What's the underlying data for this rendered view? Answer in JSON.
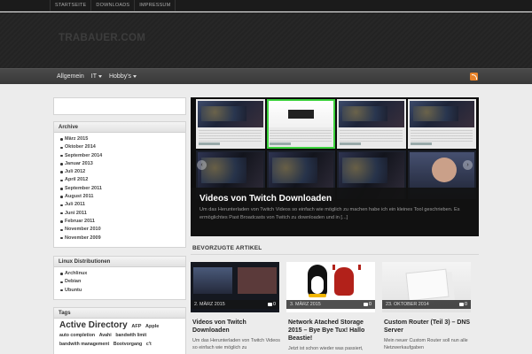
{
  "top_nav": [
    "STARTSEITE",
    "DOWNLOADS",
    "IMPRESSUM"
  ],
  "site_title": "TRABAUER.COM",
  "main_nav": [
    {
      "label": "Allgemein",
      "has_dropdown": false
    },
    {
      "label": "IT",
      "has_dropdown": true
    },
    {
      "label": "Hobby's",
      "has_dropdown": true
    }
  ],
  "rss_icon": "rss-feed-icon",
  "sidebar": {
    "search_placeholder": "",
    "archive": {
      "title": "Archive",
      "items": [
        "März 2015",
        "Oktober 2014",
        "September 2014",
        "Januar 2013",
        "Juli 2012",
        "April 2012",
        "September 2011",
        "August 2011",
        "Juli 2011",
        "Juni 2011",
        "Februar 2011",
        "November 2010",
        "November 2009"
      ]
    },
    "distros": {
      "title": "Linux Distributionen",
      "items": [
        "Archlinux",
        "Debian",
        "Ubuntu"
      ]
    },
    "tags": {
      "title": "Tags",
      "cloud": [
        {
          "label": "Active Directory",
          "size": 10
        },
        {
          "label": "AFP",
          "size": 5.5
        },
        {
          "label": "Apple",
          "size": 5.5
        },
        {
          "label": "auto completion",
          "size": 5.2
        },
        {
          "label": "Avahi",
          "size": 5.2
        },
        {
          "label": "bandwith limit",
          "size": 5.2
        },
        {
          "label": "bandwith management",
          "size": 5.2
        },
        {
          "label": "Bootvorgang",
          "size": 5.2
        },
        {
          "label": "c't",
          "size": 5.2
        }
      ]
    }
  },
  "slider": {
    "title": "Videos von Twitch Downloaden",
    "text": "Um das Herunterladen von Twitch Videos so einfach wie möglich zu machen habe ich ein kleines Tool geschrieben. Es ermöglichtes Past Broadcasts von Twitch zu downloaden und in [...]",
    "arrow_left": "‹",
    "arrow_right": "›"
  },
  "featured": {
    "heading": "BEVORZUGTE ARTIKEL",
    "cards": [
      {
        "date": "2. MÄRZ 2015",
        "comments": "0",
        "title": "Videos von Twitch Downloaden",
        "excerpt": "Um das Herunterladen von Twitch Videos so einfach wie möglich zu"
      },
      {
        "date": "3. MÄRZ 2015",
        "comments": "0",
        "title": "Network Atached Storage 2015 – Bye Bye Tux! Hallo Beastie!",
        "excerpt": "Jetzt ist schon wieder was passiert,"
      },
      {
        "date": "23. OKTOBER 2014",
        "comments": "0",
        "title": "Custom Router (Teil 3) – DNS Server",
        "excerpt": "Mein neuer Custom Router soll nun alle Netzwerkaufgaben"
      }
    ]
  }
}
